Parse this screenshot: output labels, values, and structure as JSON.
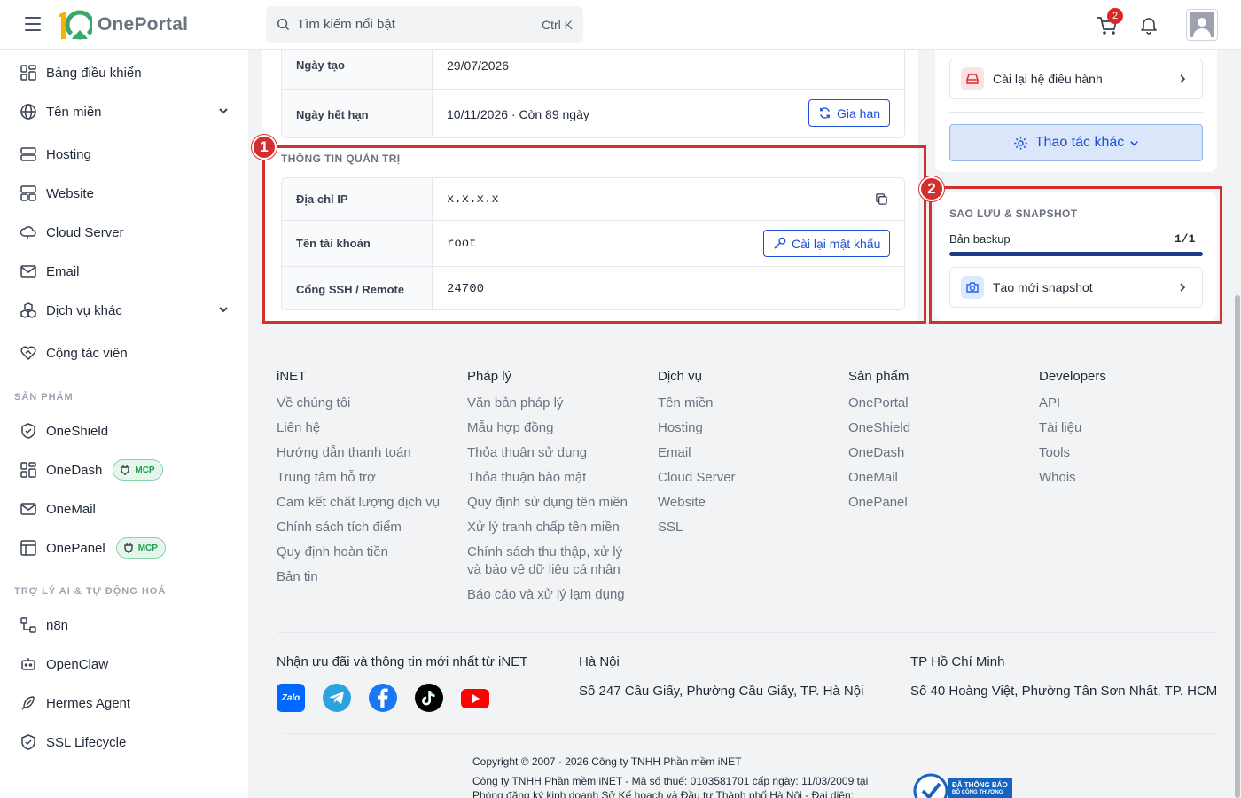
{
  "brand": {
    "logo_text": "OnePortal"
  },
  "header": {
    "search_placeholder": "Tìm kiếm nổi bật",
    "search_shortcut": "Ctrl K",
    "cart_count": "2"
  },
  "sidebar": {
    "items": [
      {
        "label": "Bảng điều khiển"
      },
      {
        "label": "Tên miền"
      },
      {
        "label": "Hosting"
      },
      {
        "label": "Website"
      },
      {
        "label": "Cloud Server"
      },
      {
        "label": "Email"
      },
      {
        "label": "Dịch vụ khác"
      },
      {
        "label": "Cộng tác viên"
      }
    ],
    "section_products": "SẢN PHẨM",
    "products": [
      {
        "label": "OneShield"
      },
      {
        "label": "OneDash",
        "badge": "MCP"
      },
      {
        "label": "OneMail"
      },
      {
        "label": "OnePanel",
        "badge": "MCP"
      }
    ],
    "section_ai": "TRỢ LÝ AI & TỰ ĐỘNG HOÁ",
    "ai_items": [
      {
        "label": "n8n"
      },
      {
        "label": "OpenClaw"
      },
      {
        "label": "Hermes Agent"
      },
      {
        "label": "SSL Lifecycle"
      }
    ]
  },
  "service_info": {
    "created_label": "Ngày tạo",
    "created_value": "29/07/2026",
    "expiry_label": "Ngày hết hạn",
    "expiry_value": "10/11/2026 · Còn 89 ngày",
    "renew_button": "Gia hạn"
  },
  "admin_info": {
    "title": "THÔNG TIN QUẢN TRỊ",
    "ip_label": "Địa chỉ IP",
    "ip_value": "x.x.x.x",
    "account_label": "Tên tài khoản",
    "account_value": "root",
    "reset_password_button": "Cài lại mật khẩu",
    "ssh_label": "Cổng SSH / Remote",
    "ssh_value": "24700"
  },
  "actions": {
    "reinstall_os": "Cài lại hệ điều hành",
    "more_actions": "Thao tác khác"
  },
  "backup": {
    "title": "SAO LƯU & SNAPSHOT",
    "backup_label": "Bản backup",
    "backup_count": "1/1",
    "backup_progress": 1.0,
    "create_snapshot": "Tạo mới snapshot"
  },
  "annotations": {
    "box1": "1",
    "box2": "2"
  },
  "footer": {
    "columns": [
      {
        "title": "iNET",
        "links": [
          "Về chúng tôi",
          "Liên hệ",
          "Hướng dẫn thanh toán",
          "Trung tâm hỗ trợ",
          "Cam kết chất lượng dịch vụ",
          "Chính sách tích điểm",
          "Quy định hoàn tiền",
          "Bản tin"
        ]
      },
      {
        "title": "Pháp lý",
        "links": [
          "Văn bản pháp lý",
          "Mẫu hợp đồng",
          "Thỏa thuận sử dụng",
          "Thỏa thuận bảo mật",
          "Quy định sử dụng tên miền",
          "Xử lý tranh chấp tên miền",
          "Chính sách thu thập, xử lý",
          "và bảo vệ dữ liệu cá nhân",
          "Báo cáo và xử lý lạm dụng"
        ]
      },
      {
        "title": "Dịch vụ",
        "links": [
          "Tên miền",
          "Hosting",
          "Email",
          "Cloud Server",
          "Website",
          "SSL"
        ]
      },
      {
        "title": "Sản phẩm",
        "links": [
          "OnePortal",
          "OneShield",
          "OneDash",
          "OneMail",
          "OnePanel"
        ]
      },
      {
        "title": "Developers",
        "links": [
          "API",
          "Tài liệu",
          "Tools",
          "Whois"
        ]
      }
    ],
    "newsletter_title": "Nhận ưu đãi và thông tin mới nhất từ iNET",
    "zalo_text": "Zalo",
    "hanoi_title": "Hà Nội",
    "hanoi_address": "Số 247 Cầu Giấy, Phường Cầu Giấy, TP. Hà Nội",
    "hcm_title": "TP Hồ Chí Minh",
    "hcm_address": "Số 40 Hoàng Việt, Phường Tân Sơn Nhất, TP. HCM",
    "copyright": "Copyright © 2007 - 2026 Công ty TNHH Phần mềm iNET",
    "company_line1": "Công ty TNHH Phần mềm iNET - Mã số thuế: 0103581701 cấp ngày: 11/03/2009 tại",
    "company_line2": "Phòng đăng ký kinh doanh Sở Kế hoạch và Đầu tư Thành phố Hà Nội - Đại diện:",
    "registered_badge_line1": "ĐÃ THÔNG BÁO",
    "registered_badge_line2": "BỘ CÔNG THƯƠNG"
  },
  "colors": {
    "accent": "#1d4ed8",
    "annotation": "#d32f2f",
    "mcp": "#16a34a"
  }
}
